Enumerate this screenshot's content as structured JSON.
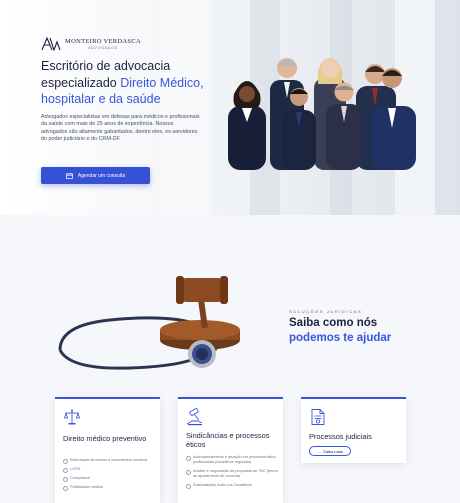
{
  "hero": {
    "logo_main": "MONTEIRO VERDASCA",
    "logo_sub": "ADVOGADOS",
    "title_line1": "Escritório de advocacia",
    "title_line2_plain": "especializado ",
    "title_line2_accent": "Direito Médico,",
    "title_line3_accent": "hospitalar e da saúde",
    "description": "Advogados especialistas em defesas para médicos e profissionais da saúde com mais de 25 anos de experiência. Nossos advogados são altamente gabaritados, dentre eles, ex-servidores do poder judiciário e do CRM-DF.",
    "cta_label": "Agendar um consulta",
    "cta_icon": "calendar-icon"
  },
  "services": {
    "eyebrow": "SOLUÇÕES JURÍDICAS",
    "title_plain": "Saiba como nós",
    "title_accent": "podemos te ajudar"
  },
  "cards": [
    {
      "icon": "scales-justice-icon",
      "title": "Direito médico preventivo",
      "items": [
        "Elaboração de termos e documentos médicos",
        "LGPD",
        "Compliance",
        "Publicidade médica"
      ]
    },
    {
      "icon": "gavel-hand-icon",
      "title": "Sindicâncias e processos éticos",
      "items": [
        "Acompanhamento e atuação em processos ético-profissionais (conselhos regionais)",
        "Análise e negociação de propostas de TAC (termo de ajustamento de conduta)",
        "Sustentações orais nos Conselhos"
      ]
    },
    {
      "icon": "legal-document-icon",
      "title": "Processos judiciais",
      "button": "Saiba mais"
    }
  ],
  "colors": {
    "accent": "#3a56d8",
    "navy": "#1d2240",
    "cta": "#3551d6"
  }
}
